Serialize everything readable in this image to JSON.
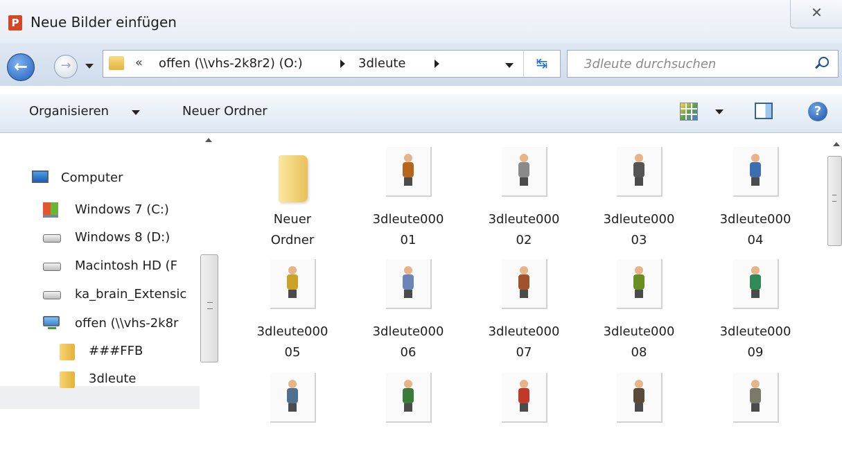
{
  "window": {
    "title": "Neue Bilder einfügen",
    "app_glyph": "P",
    "close_glyph": "✕"
  },
  "navigation": {
    "back_glyph": "←",
    "forward_glyph": "→"
  },
  "address": {
    "chevron": "«",
    "segments": [
      "offen (\\\\vhs-2k8r2) (O:)",
      "3dleute"
    ],
    "refresh_glyph": "↹"
  },
  "search": {
    "placeholder": "3dleute durchsuchen"
  },
  "toolbar": {
    "organize": "Organisieren",
    "new_folder": "Neuer Ordner",
    "help_glyph": "?"
  },
  "nav": {
    "items": [
      {
        "label": "Computer",
        "icon": "computer-icon"
      },
      {
        "label": "Windows 7 (C:)",
        "icon": "windows-drive-icon"
      },
      {
        "label": "Windows 8 (D:)",
        "icon": "drive-icon"
      },
      {
        "label": "Macintosh HD (F",
        "icon": "drive-icon"
      },
      {
        "label": "ka_brain_Extensic",
        "icon": "drive-icon"
      },
      {
        "label": "offen (\\\\vhs-2k8r",
        "icon": "network-drive-icon"
      },
      {
        "label": "###FFB",
        "icon": "folder-icon"
      },
      {
        "label": "3dleute",
        "icon": "folder-icon",
        "selected": true
      }
    ]
  },
  "files": [
    {
      "line1": "Neuer",
      "line2": "Ordner",
      "type": "folder"
    },
    {
      "line1": "3dleute000",
      "line2": "01",
      "type": "image",
      "color": "#b5651d"
    },
    {
      "line1": "3dleute000",
      "line2": "02",
      "type": "image",
      "color": "#8a8a8a"
    },
    {
      "line1": "3dleute000",
      "line2": "03",
      "type": "image",
      "color": "#555555"
    },
    {
      "line1": "3dleute000",
      "line2": "04",
      "type": "image",
      "color": "#3d6fb0"
    },
    {
      "line1": "3dleute000",
      "line2": "05",
      "type": "image",
      "color": "#c9a227"
    },
    {
      "line1": "3dleute000",
      "line2": "06",
      "type": "image",
      "color": "#6a86b8"
    },
    {
      "line1": "3dleute000",
      "line2": "07",
      "type": "image",
      "color": "#a0522d"
    },
    {
      "line1": "3dleute000",
      "line2": "08",
      "type": "image",
      "color": "#6b8e23"
    },
    {
      "line1": "3dleute000",
      "line2": "09",
      "type": "image",
      "color": "#2e8b57"
    },
    {
      "type": "image",
      "color": "#4f6f8f"
    },
    {
      "type": "image",
      "color": "#3a7a3a"
    },
    {
      "type": "image",
      "color": "#c0392b"
    },
    {
      "type": "image",
      "color": "#5a4a3a"
    },
    {
      "type": "image",
      "color": "#7a7a6a"
    }
  ],
  "colors": {
    "accent": "#1f5fbf",
    "folder": "#e6b23a"
  }
}
